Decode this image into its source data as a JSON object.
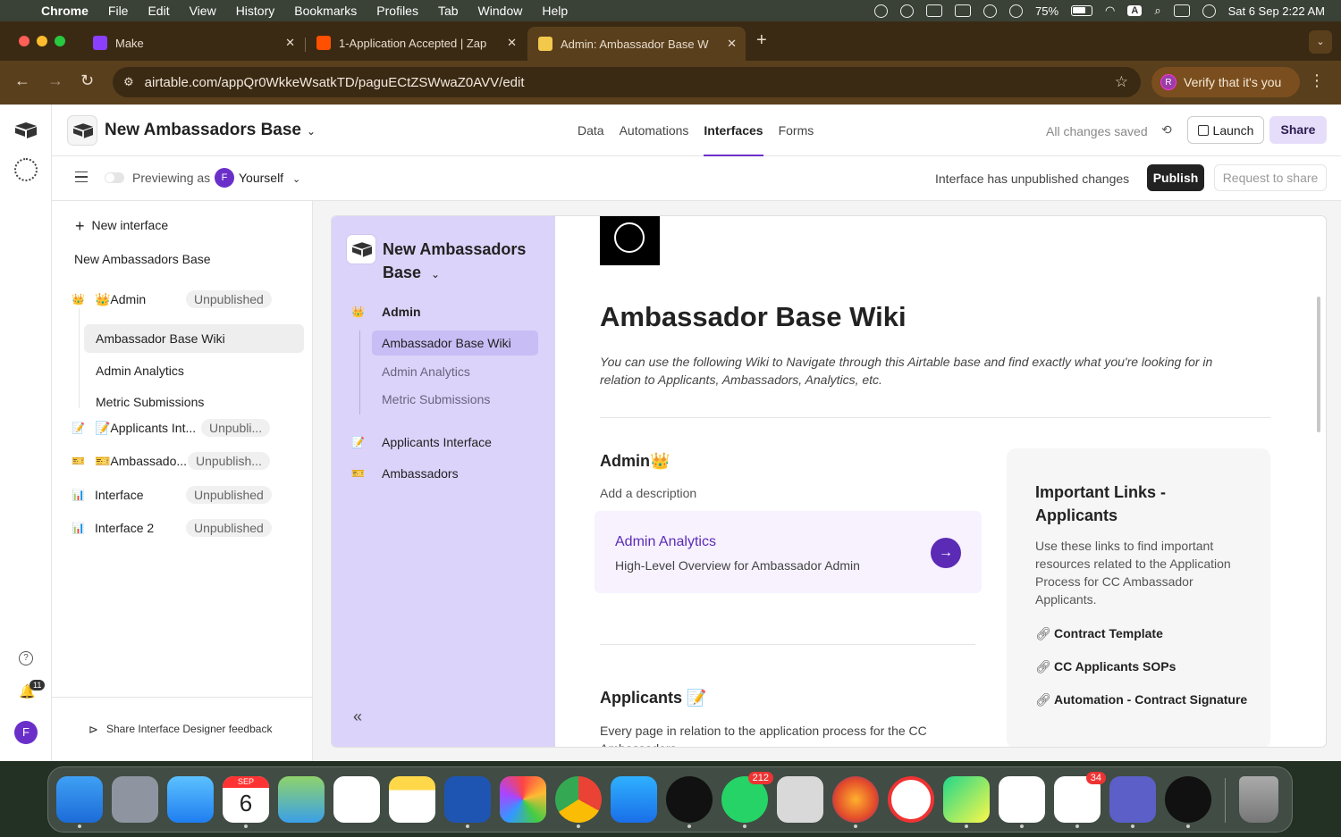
{
  "menubar": {
    "app": "Chrome",
    "items": [
      "File",
      "Edit",
      "View",
      "History",
      "Bookmarks",
      "Profiles",
      "Tab",
      "Window",
      "Help"
    ],
    "battery": "75%",
    "input_source": "A",
    "datetime": "Sat 6 Sep  2:22 AM"
  },
  "browser": {
    "tabs": [
      {
        "title": "Make",
        "color": "#8a3ffc"
      },
      {
        "title": "1-Application Accepted | Zap",
        "color": "#ff4f00"
      },
      {
        "title": "Admin: Ambassador Base W",
        "color": "#f2c94c"
      }
    ],
    "url": "airtable.com/appQr0WkkeWsatkTD/paguECtZSWwaZ0AVV/edit",
    "verify_label": "Verify that it's you",
    "verify_avatar": "R"
  },
  "topbar": {
    "base_title": "New Ambassadors Base",
    "nav": [
      "Data",
      "Automations",
      "Interfaces",
      "Forms"
    ],
    "saved": "All changes saved",
    "launch": "Launch",
    "share": "Share"
  },
  "subbar": {
    "previewing": "Previewing as",
    "avatar": "F",
    "user": "Yourself",
    "unpublished_msg": "Interface has unpublished changes",
    "publish": "Publish",
    "request_share": "Request to share"
  },
  "sidebar": {
    "new_interface": "New interface",
    "base_name": "New Ambassadors Base",
    "groups": [
      {
        "icon": "👑",
        "label": "👑Admin",
        "status": "Unpublished"
      },
      {
        "icon": "📝",
        "label": "📝Applicants Int...",
        "status": "Unpubli..."
      },
      {
        "icon": "🎫",
        "label": "🎫Ambassado...",
        "status": "Unpublish..."
      },
      {
        "icon": "📊",
        "label": "Interface",
        "status": "Unpublished"
      },
      {
        "icon": "📊",
        "label": "Interface 2",
        "status": "Unpublished"
      }
    ],
    "admin_pages": [
      "Ambassador Base Wiki",
      "Admin Analytics",
      "Metric Submissions"
    ],
    "feedback": "Share Interface Designer feedback"
  },
  "rail": {
    "notifications": "11",
    "avatar": "F"
  },
  "app": {
    "base_title": "New Ambassadors Base",
    "nav_admin": "Admin",
    "nav_admin_icon": "👑",
    "nav_admin_pages": [
      "Ambassador Base Wiki",
      "Admin Analytics",
      "Metric Submissions"
    ],
    "nav_applicants": "Applicants Interface",
    "nav_applicants_icon": "📝",
    "nav_ambassadors": "Ambassadors",
    "nav_ambassadors_icon": "🎫"
  },
  "wiki": {
    "title": "Ambassador Base Wiki",
    "description": "You can use the following Wiki to Navigate through this Airtable base and find exactly what you're looking for in relation to Applicants, Ambassadors, Analytics, etc.",
    "admin_heading": "Admin👑",
    "admin_desc": "Add a description",
    "card_title": "Admin Analytics",
    "card_sub": "High-Level Overview for Ambassador Admin",
    "applicants_heading": "Applicants 📝",
    "applicants_desc": "Every page in relation to the application process for the CC Ambassadors",
    "links_title": "Important Links - Applicants",
    "links_desc": "Use these links to find important resources related to the Application Process for CC Ambassador Applicants.",
    "links": [
      "Contract Template",
      "CC Applicants SOPs",
      "Automation - Contract Signature"
    ]
  },
  "dock": {
    "calendar_month": "SEP",
    "calendar_day": "6",
    "whatsapp_badge": "212",
    "chat_badge": "34"
  }
}
